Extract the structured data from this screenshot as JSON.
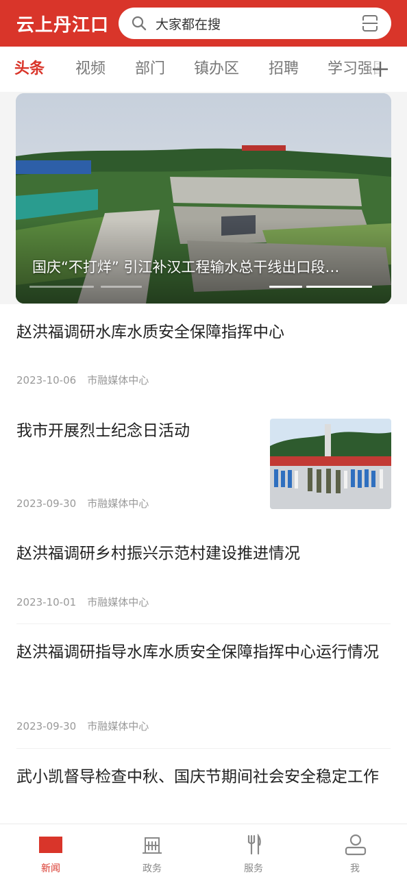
{
  "header": {
    "brand": "云上丹江口",
    "search_placeholder": "大家都在搜"
  },
  "tabs": [
    {
      "label": "头条",
      "active": true
    },
    {
      "label": "视频",
      "active": false
    },
    {
      "label": "部门",
      "active": false
    },
    {
      "label": "镇办区",
      "active": false
    },
    {
      "label": "招聘",
      "active": false
    },
    {
      "label": "学习强国",
      "active": false
    }
  ],
  "banner": {
    "title": "国庆“不打烊” 引江补汉工程输水总干线出口段…",
    "slide_count": 4,
    "active_slide": 3
  },
  "news": [
    {
      "title": "赵洪福调研水库水质安全保障指挥中心",
      "date": "2023-10-06",
      "source": "市融媒体中心",
      "has_thumb": false
    },
    {
      "title": "我市开展烈士纪念日活动",
      "date": "2023-09-30",
      "source": "市融媒体中心",
      "has_thumb": true
    },
    {
      "title": "赵洪福调研乡村振兴示范村建设推进情况",
      "date": "2023-10-01",
      "source": "市融媒体中心",
      "has_thumb": false
    },
    {
      "title": "赵洪福调研指导水库水质安全保障指挥中心运行情况",
      "date": "2023-09-30",
      "source": "市融媒体中心",
      "has_thumb": false
    },
    {
      "title": "武小凯督导检查中秋、国庆节期间社会安全稳定工作",
      "date": "",
      "source": "",
      "has_thumb": false
    }
  ],
  "bottom_nav": [
    {
      "label": "新闻",
      "icon": "news-flag-icon",
      "active": true
    },
    {
      "label": "政务",
      "icon": "building-icon",
      "active": false
    },
    {
      "label": "服务",
      "icon": "fork-knife-icon",
      "active": false
    },
    {
      "label": "我",
      "icon": "user-icon",
      "active": false
    }
  ],
  "colors": {
    "brand_red": "#d9352a",
    "text_primary": "#222222",
    "text_secondary": "#999999",
    "tab_inactive": "#777777"
  }
}
